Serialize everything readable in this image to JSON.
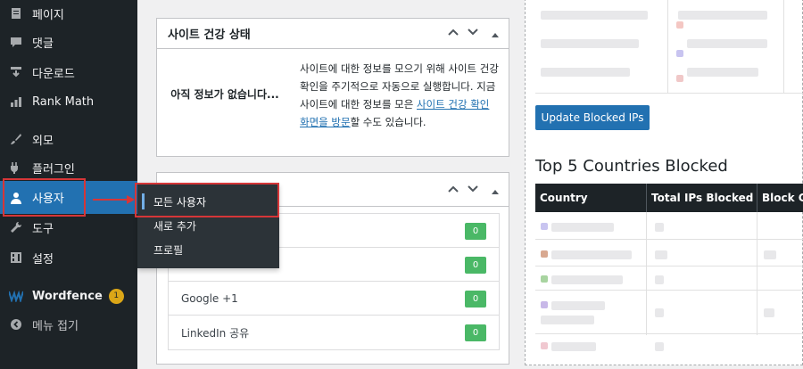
{
  "sidebar": {
    "items": [
      {
        "label": "페이지",
        "icon": "page-icon"
      },
      {
        "label": "댓글",
        "icon": "comment-icon"
      },
      {
        "label": "다운로드",
        "icon": "download-icon"
      },
      {
        "label": "Rank Math",
        "icon": "rankmath-icon"
      },
      {
        "label": "외모",
        "icon": "brush-icon"
      },
      {
        "label": "플러그인",
        "icon": "plugin-icon"
      },
      {
        "label": "사용자",
        "icon": "user-icon"
      },
      {
        "label": "도구",
        "icon": "wrench-icon"
      },
      {
        "label": "설정",
        "icon": "settings-icon"
      },
      {
        "label": "Wordfence",
        "icon": "wordfence-icon",
        "badge": "1"
      },
      {
        "label": "메뉴 접기",
        "icon": "collapse-icon"
      }
    ]
  },
  "flyout": {
    "items": [
      {
        "label": "모든 사용자"
      },
      {
        "label": "새로 추가"
      },
      {
        "label": "프로필"
      }
    ]
  },
  "site_health": {
    "title": "사이트 건강 상태",
    "status": "아직 정보가 없습니다...",
    "desc_before": "사이트에 대한 정보를 모으기 위해 사이트 건강 확인을 주기적으로 자동으로 실행합니다. 지금 사이트에 대한 정보를 모은 ",
    "desc_link": "사이트 건강 확인 화면을 방문",
    "desc_after": "할 수도 있습니다."
  },
  "social": {
    "rows": [
      {
        "label": "",
        "count": "0"
      },
      {
        "label": "",
        "count": "0"
      },
      {
        "label": "Google +1",
        "count": "0"
      },
      {
        "label": "LinkedIn 공유",
        "count": "0"
      }
    ]
  },
  "wordfence": {
    "update_button": "Update Blocked IPs",
    "top5_title": "Top 5 Countries Blocked",
    "columns": [
      "Country",
      "Total IPs Blocked",
      "Block Co"
    ]
  },
  "colors": {
    "sidebar_bg": "#1d2327",
    "active_bg": "#2271b1",
    "highlight_red": "#d63638",
    "count_green": "#4ab866",
    "badge_yellow": "#dba617"
  }
}
